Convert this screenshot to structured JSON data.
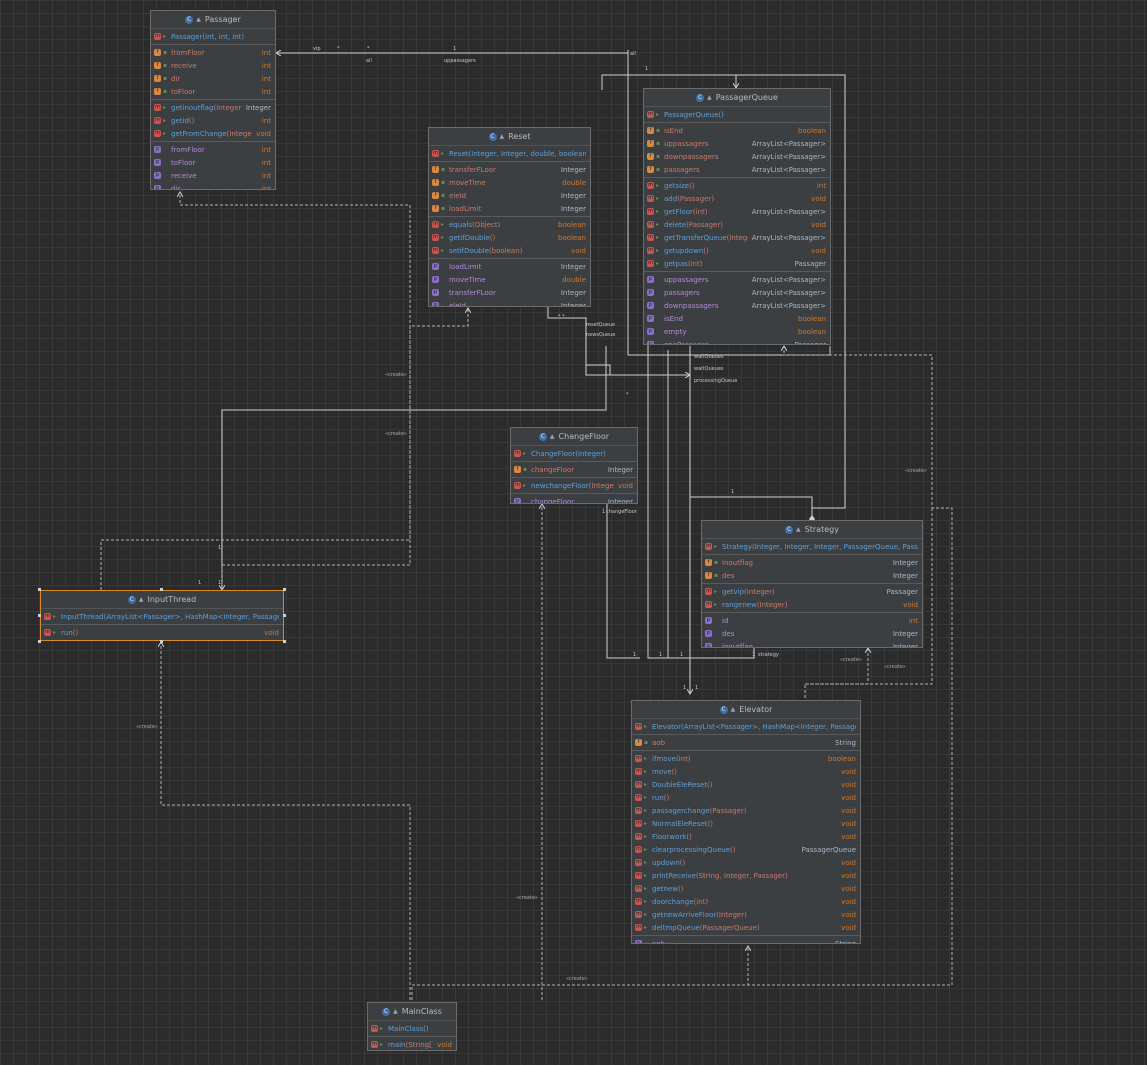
{
  "classes": {
    "passager": {
      "name": "Passager",
      "ctor": "Passager(int, int, int)",
      "fields": [
        {
          "name": "fromFloor",
          "type": "int"
        },
        {
          "name": "receive",
          "type": "int"
        },
        {
          "name": "dir",
          "type": "int"
        },
        {
          "name": "toFloor",
          "type": "int"
        }
      ],
      "methods": [
        {
          "name": "getinoutflag",
          "params": "(Integer)",
          "type": "Integer"
        },
        {
          "name": "getid",
          "params": "()",
          "type": "int"
        },
        {
          "name": "getFromChange",
          "params": "(Integer)",
          "type": "void"
        }
      ],
      "props": [
        {
          "name": "fromFloor",
          "type": "int"
        },
        {
          "name": "toFloor",
          "type": "int"
        },
        {
          "name": "receive",
          "type": "int"
        },
        {
          "name": "dir",
          "type": "int"
        }
      ]
    },
    "reset": {
      "name": "Reset",
      "ctor": "Reset(Integer, Integer, double, boolean)",
      "fields": [
        {
          "name": "transferFLoor",
          "type": "Integer"
        },
        {
          "name": "moveTime",
          "type": "double"
        },
        {
          "name": "eleId",
          "type": "Integer"
        },
        {
          "name": "loadLimit",
          "type": "Integer"
        }
      ],
      "methods": [
        {
          "name": "equals",
          "params": "(Object)",
          "type": "boolean"
        },
        {
          "name": "getifDouble",
          "params": "()",
          "type": "boolean"
        },
        {
          "name": "setifDouble",
          "params": "(boolean)",
          "type": "void"
        }
      ],
      "props": [
        {
          "name": "loadLimit",
          "type": "Integer"
        },
        {
          "name": "moveTime",
          "type": "double"
        },
        {
          "name": "transferFLoor",
          "type": "Integer"
        },
        {
          "name": "eleId",
          "type": "Integer"
        }
      ]
    },
    "passagerQueue": {
      "name": "PassagerQueue",
      "ctor": "PassagerQueue()",
      "fields": [
        {
          "name": "isEnd",
          "type": "boolean"
        },
        {
          "name": "uppassagers",
          "type": "ArrayList<Passager>"
        },
        {
          "name": "downpassagers",
          "type": "ArrayList<Passager>"
        },
        {
          "name": "passagers",
          "type": "ArrayList<Passager>"
        }
      ],
      "methods": [
        {
          "name": "getsize",
          "params": "()",
          "type": "int"
        },
        {
          "name": "add",
          "params": "(Passager)",
          "type": "void"
        },
        {
          "name": "getFloor",
          "params": "(int)",
          "type": "ArrayList<Passager>"
        },
        {
          "name": "delete",
          "params": "(Passager)",
          "type": "void"
        },
        {
          "name": "getTransferQueue",
          "params": "(Integer)",
          "type": "ArrayList<Passager>"
        },
        {
          "name": "getupdown",
          "params": "()",
          "type": "void"
        },
        {
          "name": "getpas",
          "params": "(int)",
          "type": "Passager"
        }
      ],
      "props": [
        {
          "name": "uppassagers",
          "type": "ArrayList<Passager>"
        },
        {
          "name": "passagers",
          "type": "ArrayList<Passager>"
        },
        {
          "name": "downpassagers",
          "type": "ArrayList<Passager>"
        },
        {
          "name": "isEnd",
          "type": "boolean"
        },
        {
          "name": "empty",
          "type": "boolean"
        },
        {
          "name": "onePassager",
          "type": "Passager"
        }
      ]
    },
    "changeFloor": {
      "name": "ChangeFloor",
      "ctor": "ChangeFloor(Integer)",
      "fields": [
        {
          "name": "changeFloor",
          "type": "Integer"
        }
      ],
      "methods": [
        {
          "name": "newchangeFloor",
          "params": "(Integer)",
          "type": "void"
        }
      ],
      "props": [
        {
          "name": "changeFloor",
          "type": "Integer"
        }
      ]
    },
    "strategy": {
      "name": "Strategy",
      "ctor": "Strategy(Integer, Integer, Integer, PassagerQueue, Passager",
      "fields": [
        {
          "name": "inoutflag",
          "type": "Integer"
        },
        {
          "name": "des",
          "type": "Integer"
        }
      ],
      "methods": [
        {
          "name": "getvip",
          "params": "(Integer)",
          "type": "Passager"
        },
        {
          "name": "rangenew",
          "params": "(Integer)",
          "type": "void"
        }
      ],
      "props": [
        {
          "name": "id",
          "type": "int"
        },
        {
          "name": "des",
          "type": "Integer"
        },
        {
          "name": "inoutflag",
          "type": "Integer"
        }
      ]
    },
    "inputThread": {
      "name": "InputThread",
      "ctor": "InputThread(ArrayList<Passager>, HashMap<Integer, PassagerQ",
      "methods": [
        {
          "name": "run",
          "params": "()",
          "type": "void"
        }
      ]
    },
    "elevator": {
      "name": "Elevator",
      "ctor": "Elevator(ArrayList<Passager>, HashMap<Integer, PassagerQu",
      "fields": [
        {
          "name": "aob",
          "type": "String"
        }
      ],
      "methods": [
        {
          "name": "ifmove",
          "params": "(int)",
          "type": "boolean"
        },
        {
          "name": "move",
          "params": "()",
          "type": "void"
        },
        {
          "name": "DoubleEleReset",
          "params": "()",
          "type": "void"
        },
        {
          "name": "run",
          "params": "()",
          "type": "void"
        },
        {
          "name": "passagerchange",
          "params": "(Passager)",
          "type": "void"
        },
        {
          "name": "NormalEleReset",
          "params": "()",
          "type": "void"
        },
        {
          "name": "Floorwork",
          "params": "()",
          "type": "void"
        },
        {
          "name": "clearprocessingQueue",
          "params": "()",
          "type": "PassagerQueue"
        },
        {
          "name": "updown",
          "params": "()",
          "type": "void"
        },
        {
          "name": "printReceive",
          "params": "(String, Integer, Passager)",
          "type": "void"
        },
        {
          "name": "getnew",
          "params": "()",
          "type": "void"
        },
        {
          "name": "doorchange",
          "params": "(int)",
          "type": "void"
        },
        {
          "name": "getnewArriveFloor",
          "params": "(Integer)",
          "type": "void"
        },
        {
          "name": "deltmpQueue",
          "params": "(PassagerQueue)",
          "type": "void"
        }
      ],
      "props": [
        {
          "name": "aob",
          "type": "String"
        }
      ]
    },
    "mainClass": {
      "name": "MainClass",
      "ctor": "MainClass()",
      "methods": [
        {
          "name": "main",
          "params": "(String[])",
          "type": "void"
        }
      ]
    }
  },
  "labels": {
    "vip": "vip",
    "star1": "*",
    "star2": "*",
    "one_a": "1",
    "all_a": "all",
    "all_b": "all",
    "uppassagers": "uppassagers",
    "one_b": "1",
    "resetQueue": "resetQueue",
    "newsQueue": "newsQueue",
    "dots": "* *",
    "waitQueue1": "waitQueues",
    "waitQueue2": "waitQueues",
    "processingQueue": "processingQueue",
    "star3": "*",
    "create1": "«create»",
    "create2": "«create»",
    "create3": "«create»",
    "create4": "«create»",
    "create5": "«create»",
    "create6": "«create»",
    "create7": "«create»",
    "create8": "«create»",
    "changeFloor": "changeFloor",
    "one_c": "1",
    "one_d": "1",
    "one_e": "1",
    "one_f": "1",
    "one_g": "1",
    "one_h": "1",
    "one_i": "1",
    "one_j": "1",
    "one_k": "1",
    "strategy": "strategy",
    "one_l": "1",
    "one_m": "1"
  }
}
